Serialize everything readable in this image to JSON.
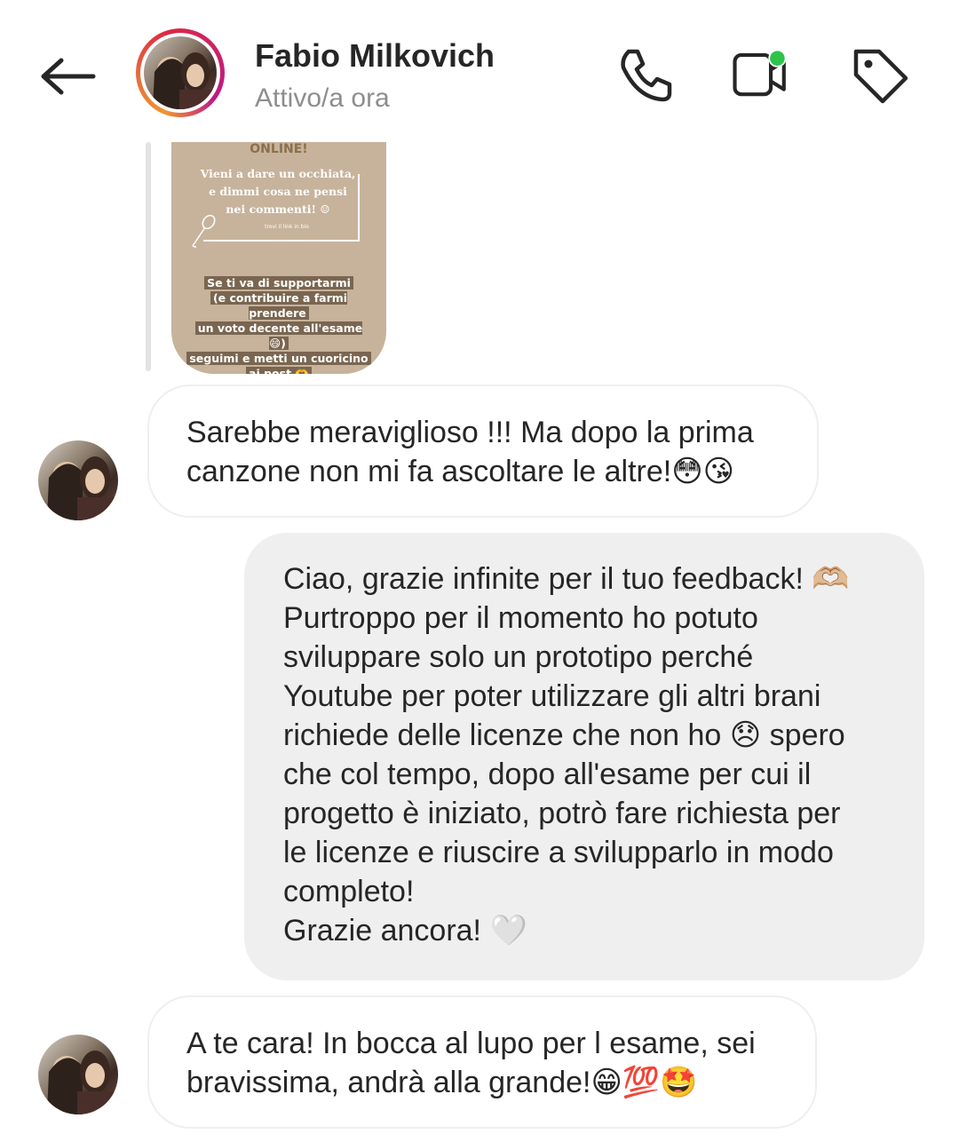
{
  "header": {
    "contact_name": "Fabio Milkovich",
    "status": "Attivo/a ora",
    "icons": [
      "back-arrow-icon",
      "phone-icon",
      "video-call-icon",
      "tag-icon"
    ],
    "online_dot_color": "#2ec44a"
  },
  "story": {
    "online": "ONLINE!",
    "line1": "Vieni a dare un occhiata,",
    "line2": "e dimmi cosa ne pensi",
    "line3": "nei commenti! ☺",
    "small": "trovi il link in bio",
    "sticker": [
      "Se ti va di supportarmi",
      "(e contribuire a farmi prendere",
      "un voto decente all'esame 😄)",
      "seguimi e metti un cuoricino",
      "ai post 🫶"
    ]
  },
  "messages": [
    {
      "direction": "incoming",
      "text": "Sarebbe meraviglioso !!! Ma dopo la prima\ncanzone non mi fa ascoltare le altre!😳😘"
    },
    {
      "direction": "outgoing",
      "text": "Ciao, grazie infinite per il tuo feedback! 🫶🏼\nPurtroppo per il momento ho potuto\nsviluppare solo un prototipo perché\nYoutube per poter utilizzare gli altri brani\nrichiede delle licenze che non ho 😞  spero\nche col tempo, dopo all'esame per cui il\nprogetto è iniziato, potrò fare richiesta per\nle licenze e riuscire a svilupparlo in modo\ncompleto!\nGrazie ancora! 🤍"
    },
    {
      "direction": "incoming",
      "text": "A te cara! In bocca al lupo per l esame, sei\nbravissima, andrà alla grande!😁💯🤩"
    }
  ]
}
